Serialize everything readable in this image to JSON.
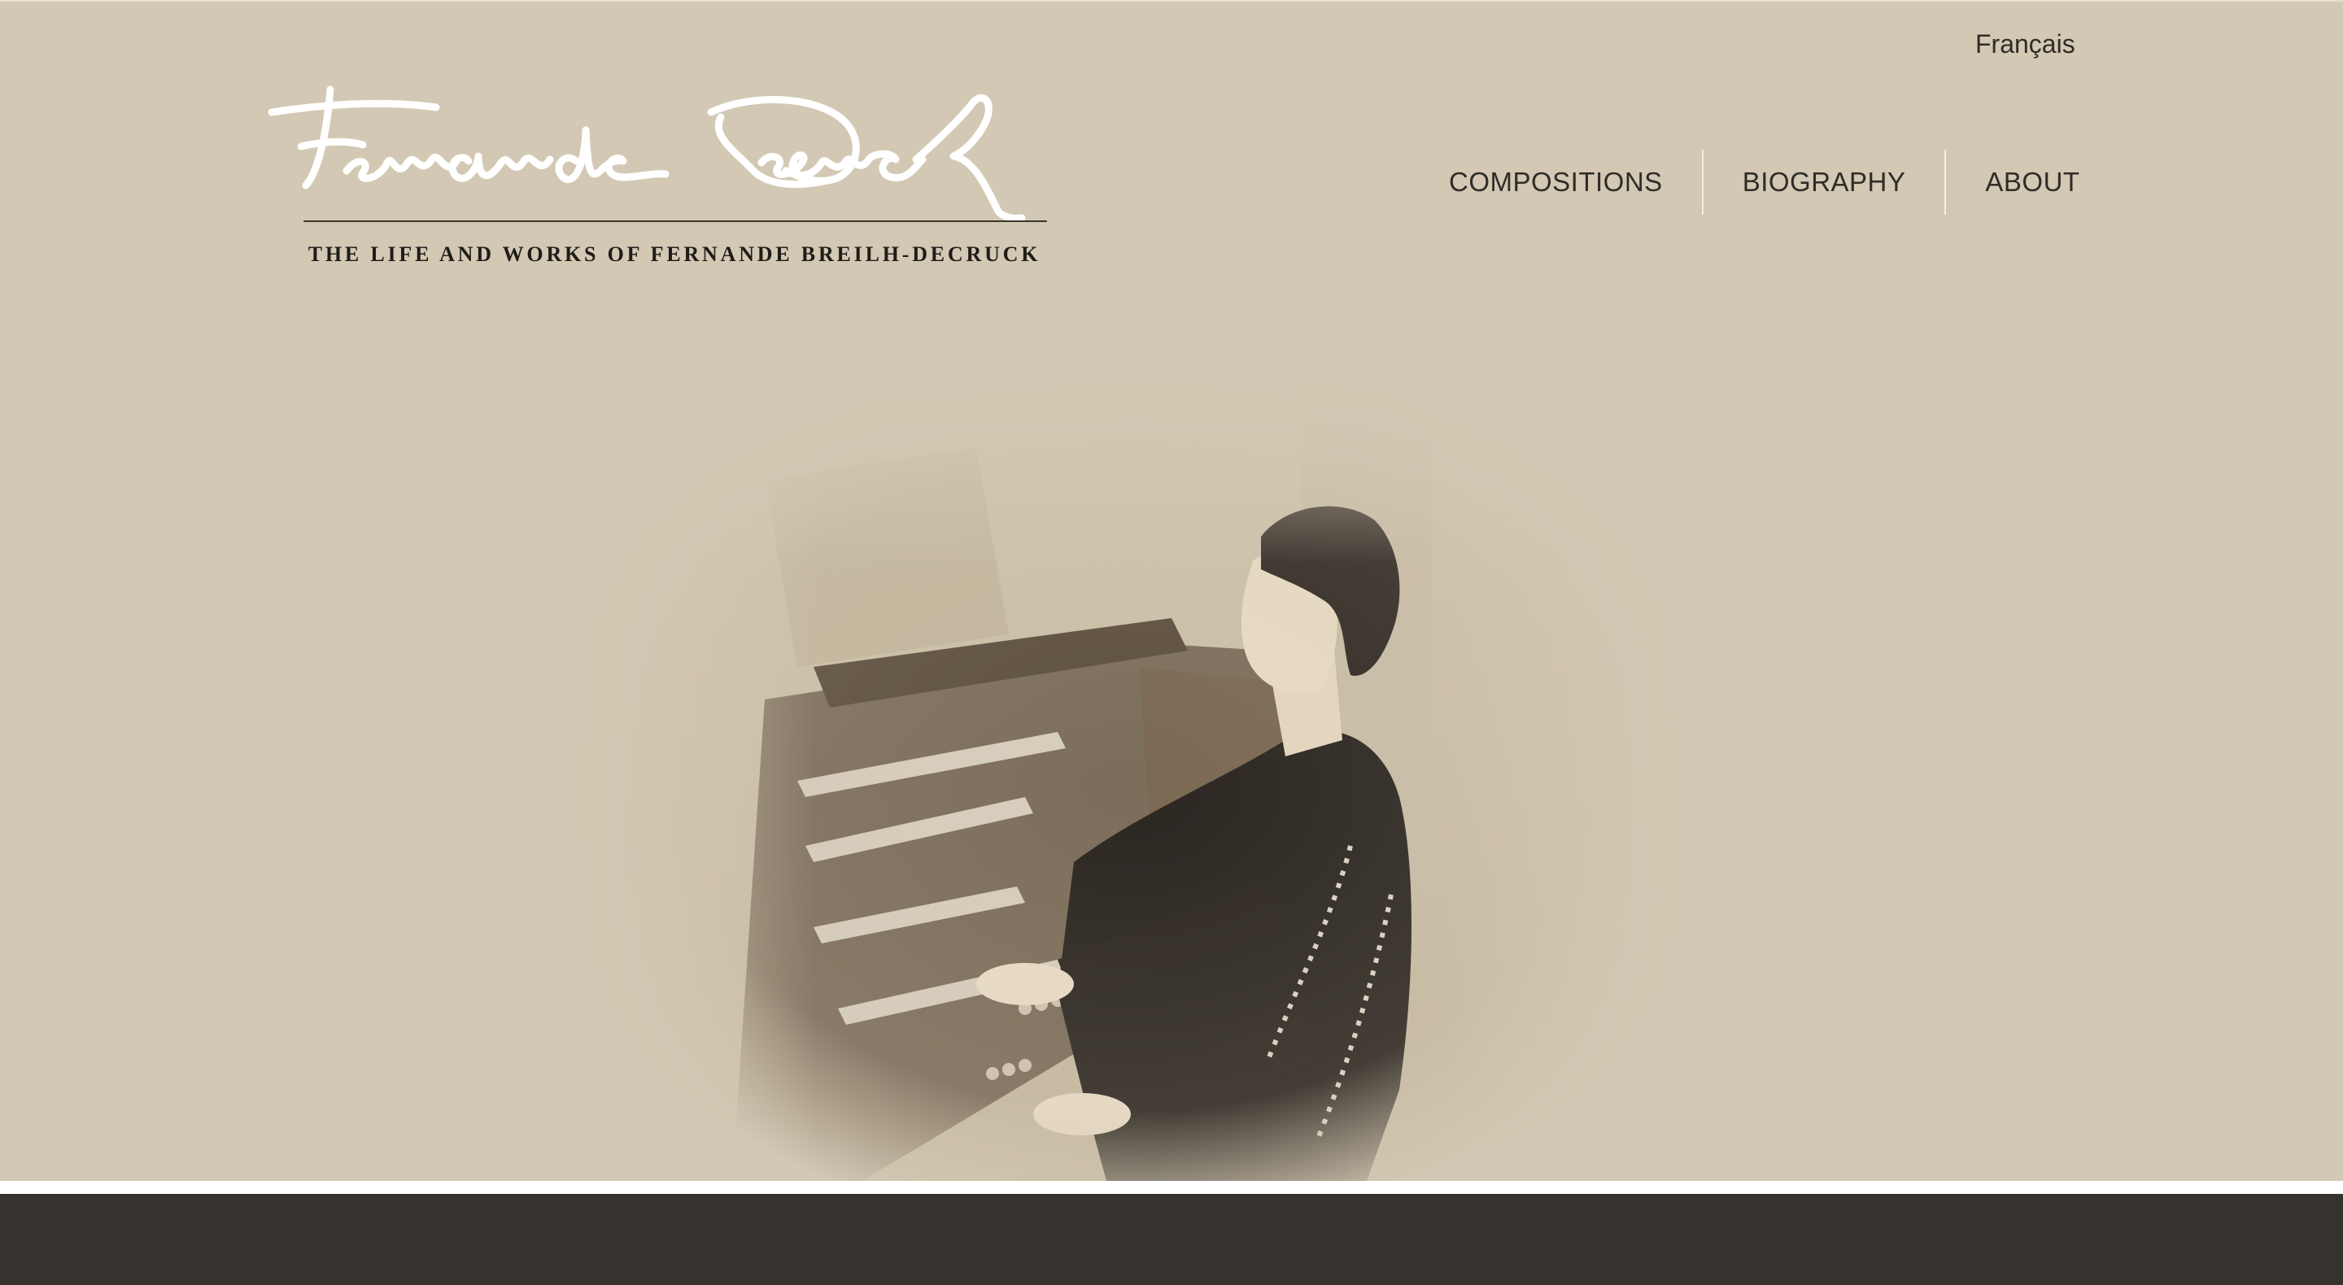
{
  "header": {
    "language_link": "Français",
    "logo_signature": "Fernande Decruck",
    "tagline": "THE LIFE AND WORKS OF FERNANDE BREILH-DECRUCK"
  },
  "nav": {
    "items": [
      {
        "label": "COMPOSITIONS"
      },
      {
        "label": "BIOGRAPHY"
      },
      {
        "label": "ABOUT"
      }
    ]
  },
  "hero": {
    "image": "sepia-photo-woman-at-organ"
  },
  "colors": {
    "background": "#d3c8b3",
    "footer": "#36332e",
    "text": "#2f2d28",
    "signature": "#ffffff"
  }
}
